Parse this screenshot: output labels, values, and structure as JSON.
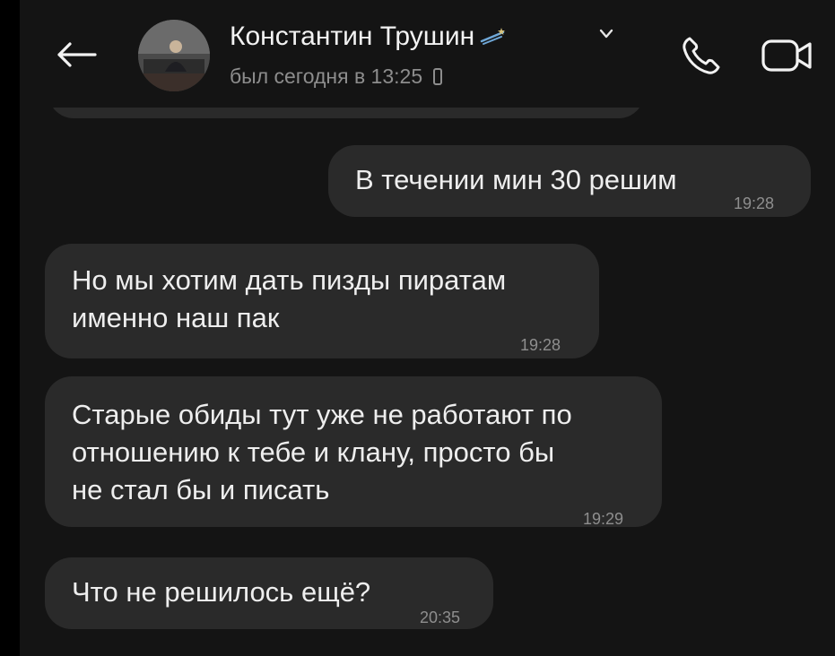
{
  "header": {
    "back_icon": "arrow-left-icon",
    "contact_name": "Константин Трушин",
    "status": "был сегодня в 13:25",
    "call_icon": "phone-icon",
    "video_icon": "video-camera-icon",
    "colors": {
      "background": "#141414",
      "bubble": "#2a2a2a",
      "text": "#eeeeee",
      "muted": "#8d8d8d"
    }
  },
  "messages": [
    {
      "direction": "outgoing",
      "text": "В течении мин 30 решим",
      "time": "19:28"
    },
    {
      "direction": "incoming",
      "text": "Но мы хотим дать пизды пиратам\nименно наш пак",
      "time": "19:28"
    },
    {
      "direction": "incoming",
      "text": "Старые обиды тут уже не работают по\nотношению к тебе и клану, просто бы\nне стал бы и писать",
      "time": "19:29"
    },
    {
      "direction": "incoming",
      "text": "Что не решилось ещё?",
      "time": "20:35"
    }
  ]
}
